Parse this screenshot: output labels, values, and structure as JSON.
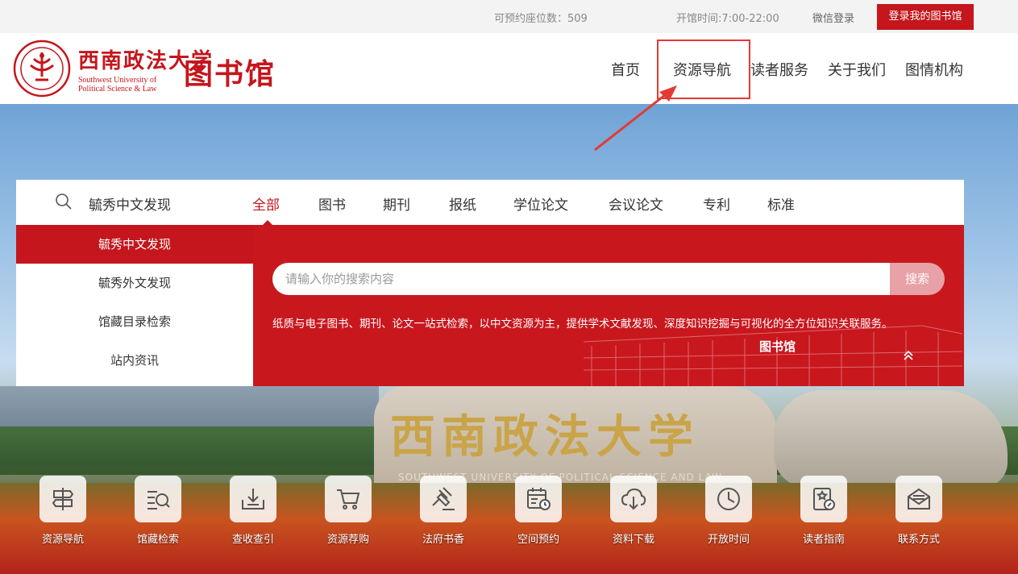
{
  "topbar": {
    "seats": "可预约座位数：509",
    "hours": "开馆时间:7:00-22:00",
    "wechat_login": "微信登录",
    "login_button": "登录我的图书馆"
  },
  "header": {
    "logo_cn": "西南政法大学",
    "logo_en_line1": "Southwest University of",
    "logo_en_line2": "Political Science & Law",
    "logo_library": "图书馆",
    "nav": [
      "首页",
      "资源导航",
      "读者服务",
      "关于我们",
      "图情机构"
    ]
  },
  "hero": {
    "stone_text": "西南政法大学",
    "stone_en": "SOUTHWEST UNIVERSITY OF POLITICAL SCIENCE AND LAW"
  },
  "search": {
    "current_engine": "毓秀中文发现",
    "tabs": [
      "全部",
      "图书",
      "期刊",
      "报纸",
      "学位论文",
      "会议论文",
      "专利",
      "标准"
    ],
    "active_tab": "全部",
    "side_items": [
      "毓秀中文发现",
      "毓秀外文发现",
      "馆藏目录检索",
      "站内资讯"
    ],
    "active_side": "毓秀中文发现",
    "placeholder": "请输入你的搜索内容",
    "button": "搜索",
    "description": "纸质与电子图书、期刊、论文一站式检索，以中文资源为主，提供学术文献发现、深度知识挖掘与可视化的全方位知识关联服务。",
    "sketch_title": "图书馆"
  },
  "quick_links": [
    {
      "label": "资源导航",
      "icon": "signpost-icon"
    },
    {
      "label": "馆藏检索",
      "icon": "catalog-search-icon"
    },
    {
      "label": "查收查引",
      "icon": "inbox-download-icon"
    },
    {
      "label": "资源荐购",
      "icon": "shopping-cart-icon"
    },
    {
      "label": "法府书香",
      "icon": "gavel-icon"
    },
    {
      "label": "空间预约",
      "icon": "calendar-clock-icon"
    },
    {
      "label": "资料下载",
      "icon": "cloud-download-icon"
    },
    {
      "label": "开放时间",
      "icon": "clock-icon"
    },
    {
      "label": "读者指南",
      "icon": "guide-book-icon"
    },
    {
      "label": "联系方式",
      "icon": "envelope-icon"
    }
  ],
  "colors": {
    "brand_red": "#c4161c",
    "annotation_red": "#e53935"
  }
}
